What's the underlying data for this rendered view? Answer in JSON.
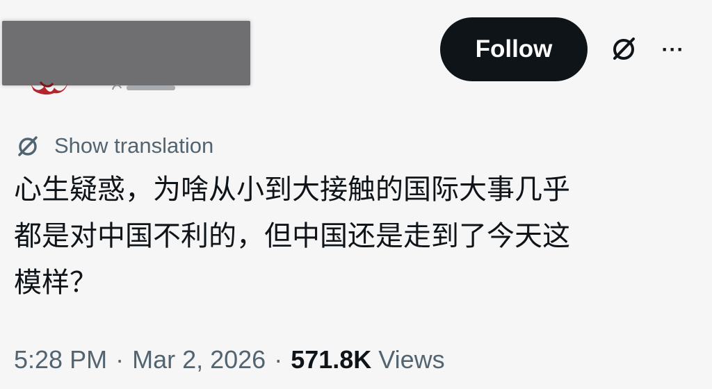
{
  "header": {
    "follow_label": "Follow",
    "grok_icon": "grok-slash-circle-icon",
    "more_icon": "more-dots-icon",
    "more_label": "···"
  },
  "translation": {
    "label": "Show translation",
    "icon": "grok-slash-circle-icon"
  },
  "tweet": {
    "lines": [
      "心生疑惑，为啥从小到大接触的国际大事几乎",
      "都是对中国不利的，但中国还是走到了今天这",
      "模样？"
    ]
  },
  "meta": {
    "time": "5:28 PM",
    "separator": "·",
    "date": "Mar 2, 2026",
    "views_count": "571.8K",
    "views_label": "Views"
  },
  "colors": {
    "text": "#0f1419",
    "secondary": "#536471",
    "follow_bg": "#0f1419",
    "follow_text": "#ffffff",
    "background": "#f6f6f7",
    "redaction": "#6f6f72",
    "avatar_accent": "#b3262d"
  }
}
